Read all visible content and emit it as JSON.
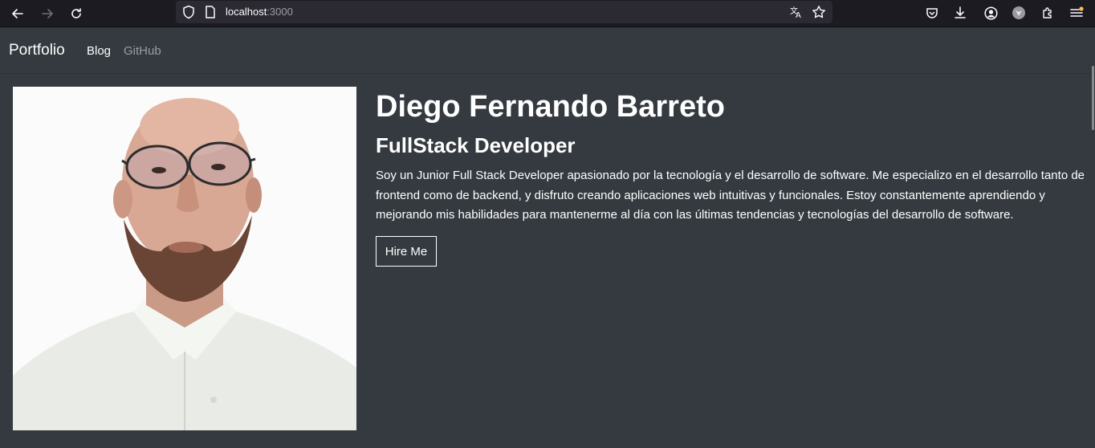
{
  "browser": {
    "url_host": "localhost",
    "url_port": ":3000"
  },
  "nav": {
    "brand": "Portfolio",
    "links": [
      {
        "label": "Blog",
        "active": true
      },
      {
        "label": "GitHub",
        "active": false
      }
    ]
  },
  "hero": {
    "name": "Diego Fernando Barreto",
    "role": "FullStack Developer",
    "bio": "Soy un Junior Full Stack Developer apasionado por la tecnología y el desarrollo de software. Me especializo en el desarrollo tanto de frontend como de backend, y disfruto creando aplicaciones web intuitivas y funcionales. Estoy constantemente aprendiendo y mejorando mis habilidades para mantenerme al día con las últimas tendencias y tecnologías del desarrollo de software.",
    "cta_label": "Hire Me"
  },
  "colors": {
    "page_bg": "#343a40",
    "chrome_bg": "#1c1b22",
    "url_bg": "#2b2a33",
    "text": "#ffffff",
    "muted_link": "#9a9ea3"
  }
}
